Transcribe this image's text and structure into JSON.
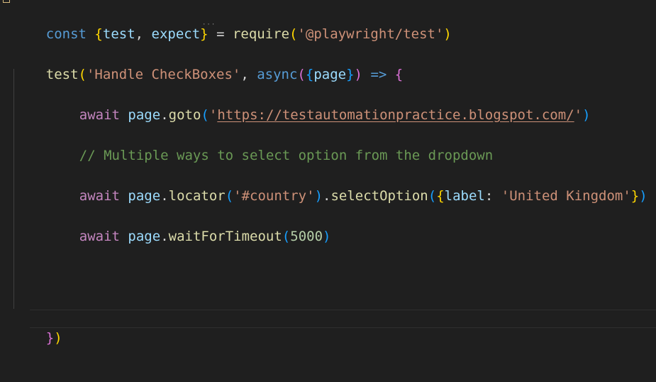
{
  "editor": {
    "line1": {
      "kw_const": "const",
      "brace_open": "{",
      "var_test": "test",
      "comma": ", ",
      "var_expect": "expect",
      "brace_close": "}",
      "eq": " = ",
      "fn_require": "require",
      "paren_open": "(",
      "str_module": "'@playwright/test'",
      "paren_close": ")"
    },
    "line2": {
      "fn_test": "test",
      "paren_open": "(",
      "str_title": "'Handle CheckBoxes'",
      "comma": ", ",
      "kw_async": "async",
      "paren2_open": "(",
      "brace_open": "{",
      "var_page": "page",
      "brace_close": "}",
      "paren2_close": ")",
      "arrow": " => ",
      "brace_body": "{"
    },
    "line3": {
      "kw_await": "await",
      "var_page": "page",
      "dot": ".",
      "fn_goto": "goto",
      "paren_open": "(",
      "str_q1": "'",
      "str_url": "https://testautomationpractice.blogspot.com/",
      "str_q2": "'",
      "paren_close": ")"
    },
    "line4": {
      "comment": "// Multiple ways to select option from the dropdown"
    },
    "line5": {
      "kw_await": "await",
      "var_page": "page",
      "dot1": ".",
      "fn_locator": "locator",
      "paren_open": "(",
      "str_selector": "'#country'",
      "paren_close": ")",
      "dot2": ".",
      "fn_select": "selectOption",
      "paren2_open": "(",
      "brace_open": "{",
      "var_label": "label",
      "colon": ": ",
      "str_value": "'United Kingdom'",
      "brace_close": "}",
      "paren2_close": ")"
    },
    "line6": {
      "kw_await": "await",
      "var_page": "page",
      "dot": ".",
      "fn_wait": "waitForTimeout",
      "paren_open": "(",
      "num": "5000",
      "paren_close": ")"
    },
    "line7": {
      "brace_close": "}",
      "paren_close": ")"
    },
    "squiggle": "···"
  }
}
